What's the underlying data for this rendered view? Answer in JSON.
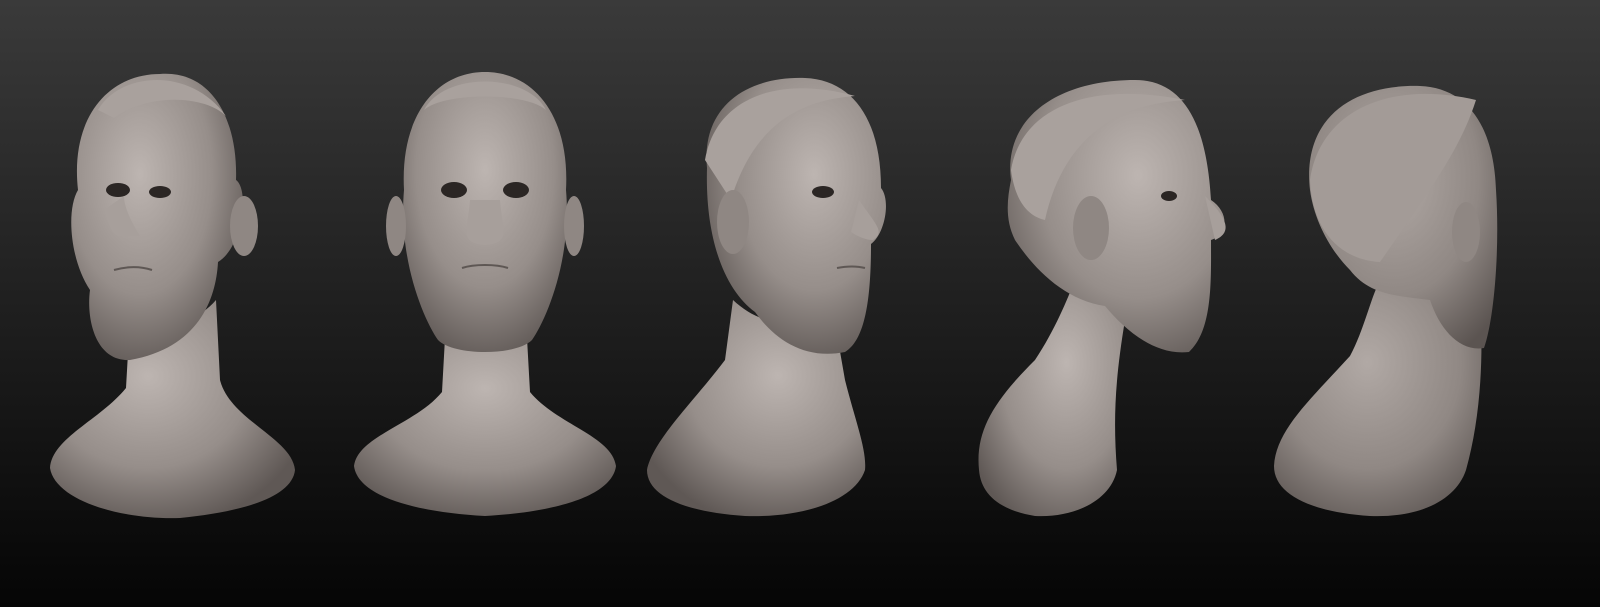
{
  "scene": {
    "background_top": "#3a3a3a",
    "background_bottom": "#050505",
    "clay_light": "#b4aca8",
    "clay_mid": "#938b87",
    "clay_dark": "#5e5754"
  },
  "views": [
    {
      "name": "three-quarter-left"
    },
    {
      "name": "front"
    },
    {
      "name": "three-quarter-right"
    },
    {
      "name": "profile-right"
    },
    {
      "name": "back-three-quarter"
    }
  ]
}
